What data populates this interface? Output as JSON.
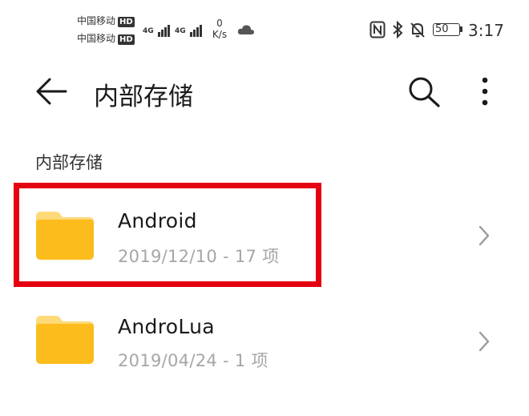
{
  "status_bar": {
    "carrier_1": "中国移动",
    "carrier_2": "中国移动",
    "hd_badge": "HD",
    "signal_1": "4G",
    "signal_2": "4G",
    "speed_value": "0",
    "speed_unit": "K/s",
    "battery": "50",
    "time": "3:17"
  },
  "header": {
    "title": "内部存储"
  },
  "breadcrumb": {
    "label": "内部存储"
  },
  "files": [
    {
      "name": "Android",
      "meta": "2019/12/10 - 17 项",
      "icon": "folder-icon",
      "highlighted": true
    },
    {
      "name": "AndroLua",
      "meta": "2019/04/24 - 1 项",
      "icon": "folder-icon",
      "highlighted": false
    }
  ],
  "colors": {
    "folder": "#FBBC1C",
    "folder_tab": "#FDD978",
    "highlight": "#E5000F",
    "meta_text": "#A6A6A6"
  }
}
